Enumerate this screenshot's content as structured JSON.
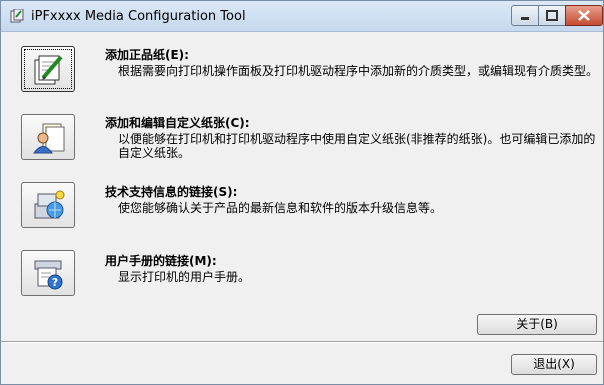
{
  "window": {
    "title": "iPFxxxx  Media Configuration Tool"
  },
  "items": [
    {
      "heading": "添加正品纸(E):",
      "description": "根据需要向打印机操作面板及打印机驱动程序中添加新的介质类型，或编辑现有介质类型。",
      "icon": "paper-edit-icon"
    },
    {
      "heading": "添加和编辑自定义纸张(C):",
      "description": "以便能够在打印机和打印机驱动程序中使用自定义纸张(非推荐的纸张)。也可编辑已添加的自定义纸张。",
      "icon": "custom-paper-user-icon"
    },
    {
      "heading": "技术支持信息的链接(S):",
      "description": "使您能够确认关于产品的最新信息和软件的版本升级信息等。",
      "icon": "support-globe-icon"
    },
    {
      "heading": "用户手册的链接(M):",
      "description": "显示打印机的用户手册。",
      "icon": "manual-help-icon"
    }
  ],
  "buttons": {
    "about": "关于(B)",
    "exit": "退出(X)"
  }
}
